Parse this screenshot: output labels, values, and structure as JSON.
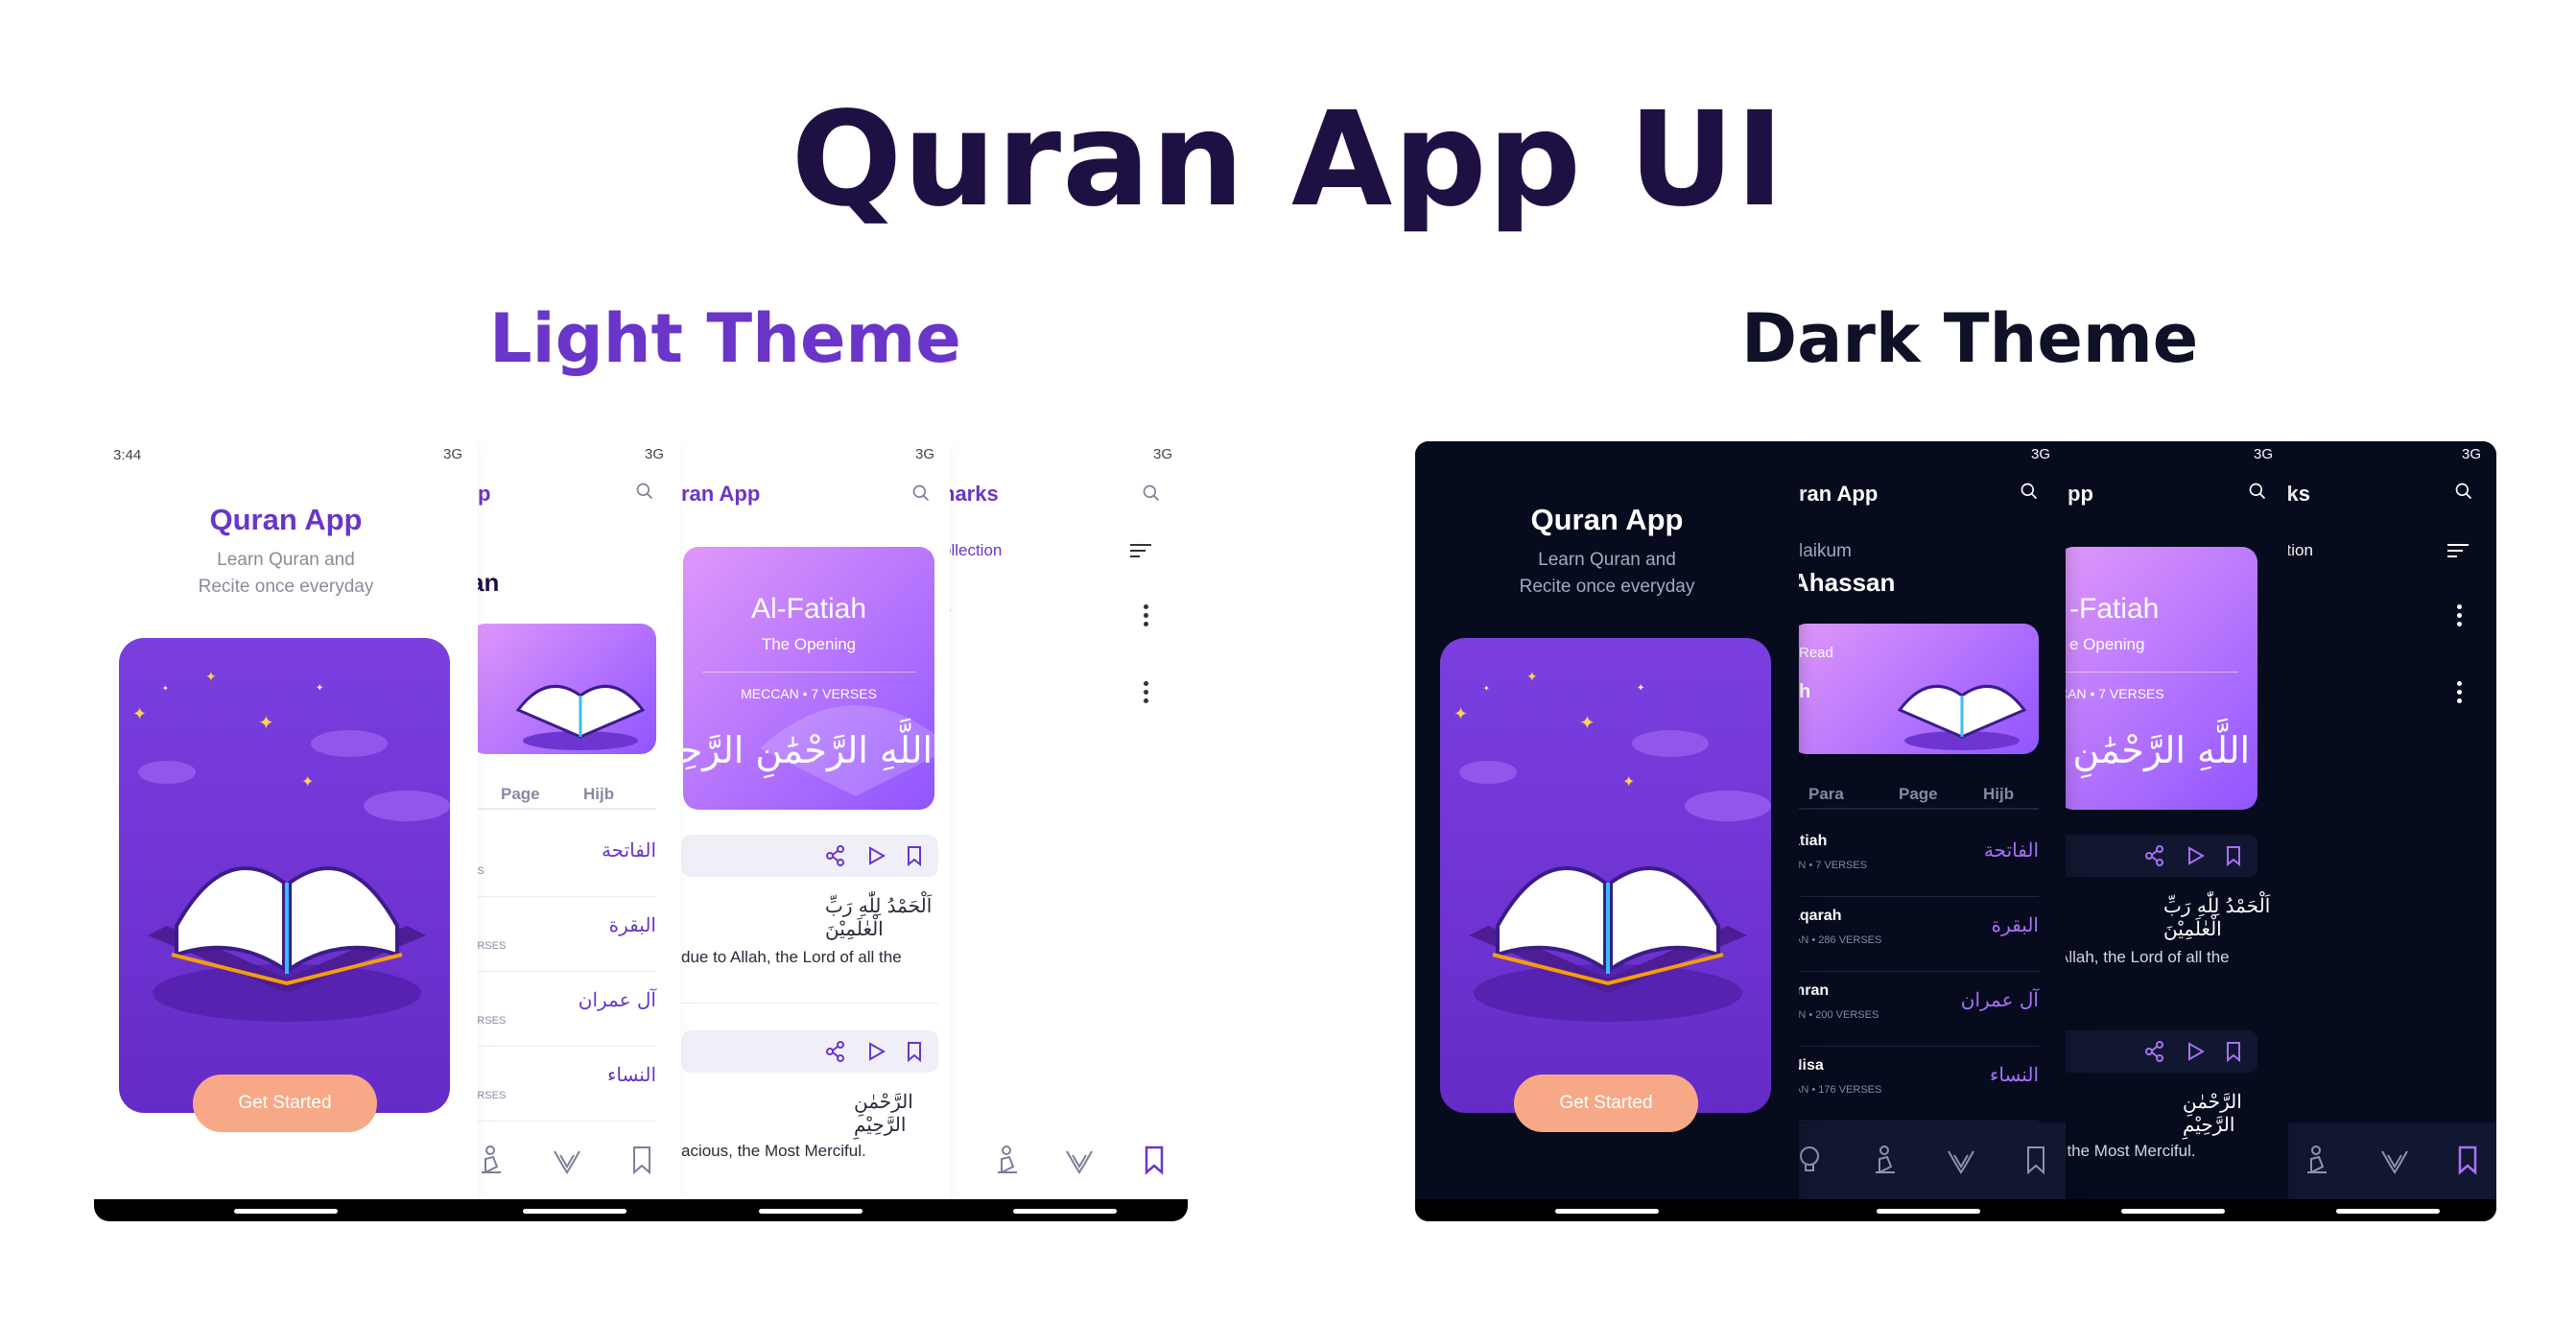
{
  "page_title": "Quran App UI",
  "light_title": "Light Theme",
  "dark_title": "Dark Theme",
  "status": {
    "time": "3:44",
    "network": "3G"
  },
  "splash": {
    "title": "Quran App",
    "subtitle_line1": "Learn Quran and",
    "subtitle_line2": "Recite once everyday",
    "button": "Get Started"
  },
  "home": {
    "header_fragment": "p",
    "dark_header": "ran App",
    "greeting": "laikum",
    "name_light": "an",
    "name_dark": "Ahassan",
    "last_read_fragment": "Read",
    "last_read_surah_fragment": "h",
    "tabs": [
      "Para",
      "Page",
      "Hijb"
    ],
    "surahs": [
      {
        "en": "atiah",
        "meta": "AN • 7 VERSES",
        "light_meta": "ES",
        "ar": "الفاتحة"
      },
      {
        "en": "aqarah",
        "meta": "IAN • 286 VERSES",
        "light_meta": "ERSES",
        "ar": "البقرة"
      },
      {
        "en": "mran",
        "meta": "AN • 200 VERSES",
        "light_meta": "ERSES",
        "ar": "آل عمران"
      },
      {
        "en": "Nisa",
        "meta": "IAN • 176 VERSES",
        "light_meta": "ERSES",
        "ar": "النساء"
      }
    ]
  },
  "detail": {
    "header": "ran App",
    "dark_header": "pp",
    "surah_name": "Al-Fatiah",
    "dark_surah_name": "-Fatiah",
    "surah_meaning": "The Opening",
    "dark_surah_meaning": "e Opening",
    "surah_meta": "MECCAN • 7 VERSES",
    "dark_surah_meta": "CAN • 7 VERSES",
    "bismillah": "بِسْمِ اللَّهِ الرَّحْمَٰنِ الرَّحِيمِ",
    "ayah1_ar": "اَلْحَمْدُ لِلّٰهِ رَبِّ الْعٰلَمِيْنَ",
    "ayah1_en": "due to Allah, the Lord of all the",
    "dark_ayah1_en": "Allah, the Lord of all the",
    "ayah2_ar": "الرَّحْمٰنِ الرَّحِيْمِ",
    "ayah2_en": "acious, the Most Merciful.",
    "dark_ayah2_en": ", the Most Merciful."
  },
  "bookmarks": {
    "header": "narks",
    "dark_header": "rks",
    "collection_link": "ollection",
    "dark_collection_link": "ction",
    "item_fragment": "e"
  },
  "colors": {
    "brand_purple": "#6a35c9",
    "title_navy": "#1f1044",
    "dark_bg": "#060b1e",
    "button_peach": "#f7a987"
  },
  "icons": [
    "search-icon",
    "share-icon",
    "play-icon",
    "bookmark-icon",
    "lamp-icon",
    "prayer-icon",
    "dua-icon",
    "sort-icon",
    "kebab-menu-icon"
  ]
}
